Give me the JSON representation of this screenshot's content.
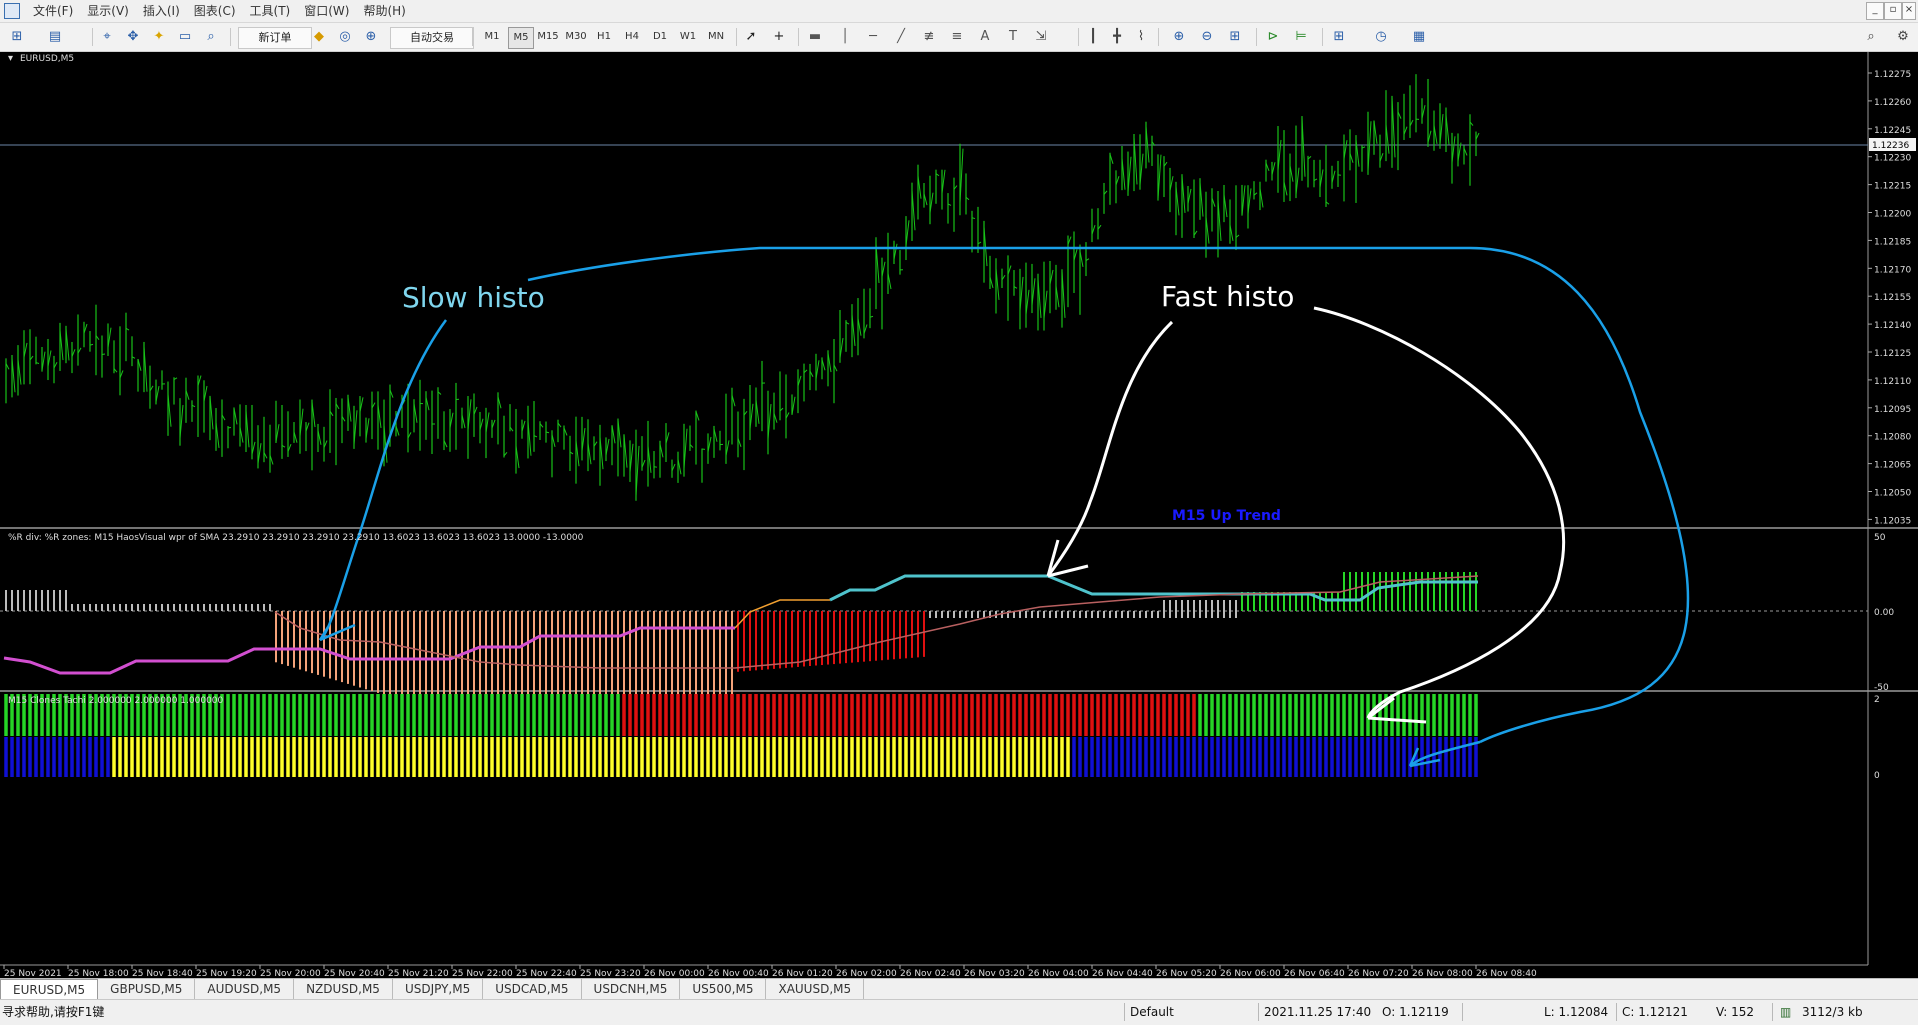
{
  "menu": [
    "文件(F)",
    "显示(V)",
    "插入(I)",
    "图表(C)",
    "工具(T)",
    "窗口(W)",
    "帮助(H)"
  ],
  "toolbar": {
    "new_order": "新订单",
    "autotrade": "自动交易"
  },
  "timeframes": [
    "M1",
    "M5",
    "M15",
    "M30",
    "H1",
    "H4",
    "D1",
    "W1",
    "MN"
  ],
  "active_timeframe": "M5",
  "chart": {
    "symbol_label": "EURUSD,M5",
    "current_price": "1.12236",
    "price_ticks": [
      "1.12275",
      "1.12260",
      "1.12245",
      "1.12230",
      "1.12215",
      "1.12200",
      "1.12185",
      "1.12170",
      "1.12155",
      "1.12140",
      "1.12125",
      "1.12110",
      "1.12095",
      "1.12080",
      "1.12065",
      "1.12050",
      "1.12035"
    ],
    "annotation_slow": "Slow histo",
    "annotation_fast": "Fast histo",
    "trend_label": "M15 Up Trend",
    "colors": {
      "bars": "#19c219",
      "cyan": "#4fc3cc",
      "magenta": "#d24fd0",
      "salmon": "#f4a37a",
      "red": "#e01010",
      "green": "#26d626",
      "yellow": "#ffff2a",
      "blue": "#1010d4",
      "trend": "#1a1aff"
    }
  },
  "indicator1": {
    "label": "%R div: %R zones: M15 HaosVisual wpr of SMA 23.2910 23.2910 23.2910 23.2910 13.6023 13.6023 13.6023 13.0000 -13.0000",
    "ticks": [
      "50",
      "0.00",
      "-50"
    ]
  },
  "indicator2": {
    "label": "M15 Clones Tachi 2.000000 2.000000 1.000000",
    "ticks": [
      "2",
      "0"
    ]
  },
  "time_axis": [
    "25 Nov 2021",
    "25 Nov 18:00",
    "25 Nov 18:40",
    "25 Nov 19:20",
    "25 Nov 20:00",
    "25 Nov 20:40",
    "25 Nov 21:20",
    "25 Nov 22:00",
    "25 Nov 22:40",
    "25 Nov 23:20",
    "26 Nov 00:00",
    "26 Nov 00:40",
    "26 Nov 01:20",
    "26 Nov 02:00",
    "26 Nov 02:40",
    "26 Nov 03:20",
    "26 Nov 04:00",
    "26 Nov 04:40",
    "26 Nov 05:20",
    "26 Nov 06:00",
    "26 Nov 06:40",
    "26 Nov 07:20",
    "26 Nov 08:00",
    "26 Nov 08:40"
  ],
  "tabs": [
    "EURUSD,M5",
    "GBPUSD,M5",
    "AUDUSD,M5",
    "NZDUSD,M5",
    "USDJPY,M5",
    "USDCAD,M5",
    "USDCNH,M5",
    "US500,M5",
    "XAUUSD,M5"
  ],
  "active_tab": "EURUSD,M5",
  "status": {
    "help": "寻求帮助,请按F1键",
    "profile": "Default",
    "datetime": "2021.11.25 17:40",
    "open": "O: 1.12119",
    "low": "L: 1.12084",
    "close": "C: 1.12121",
    "volume": "V: 152",
    "traffic": "3112/3 kb"
  }
}
